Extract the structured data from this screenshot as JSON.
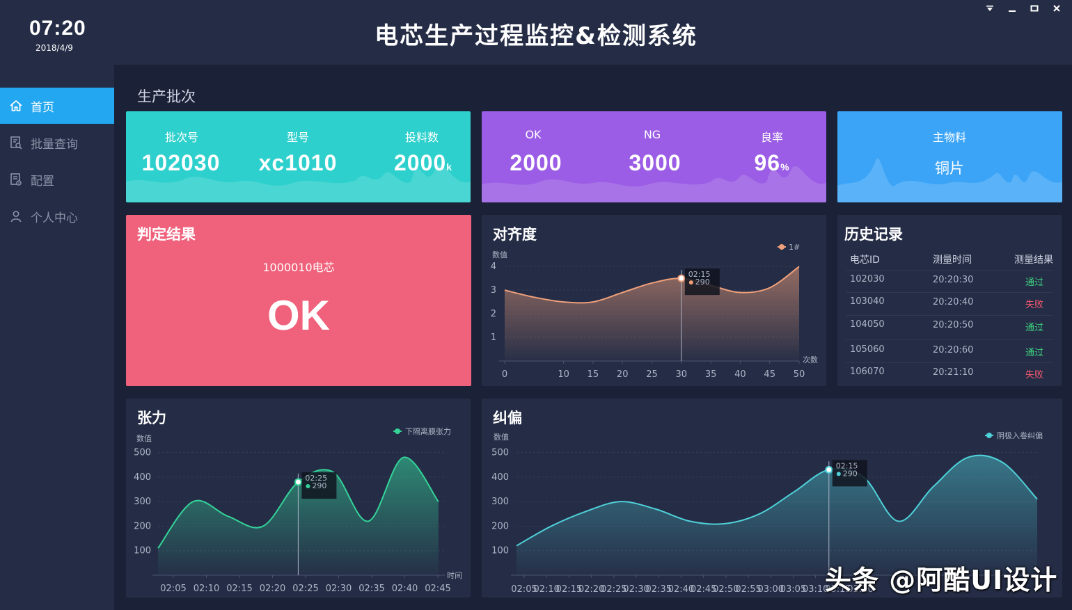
{
  "header": {
    "time": "07:20",
    "date": "2018/4/9",
    "title": "电芯生产过程监控&检测系统"
  },
  "window_controls": [
    "dropdown-icon",
    "minimize-icon",
    "maximize-icon",
    "close-icon"
  ],
  "sidebar": {
    "items": [
      {
        "label": "首页",
        "icon": "home-icon",
        "active": true
      },
      {
        "label": "批量查询",
        "icon": "search-doc-icon",
        "active": false
      },
      {
        "label": "配置",
        "icon": "config-doc-icon",
        "active": false
      },
      {
        "label": "个人中心",
        "icon": "user-icon",
        "active": false
      }
    ]
  },
  "batch": {
    "section_title": "生产批次",
    "card1": {
      "color": "#2dd0cc",
      "items": [
        {
          "label": "批次号",
          "value": "102030",
          "unit": ""
        },
        {
          "label": "型号",
          "value": "xc1010",
          "unit": ""
        },
        {
          "label": "投料数",
          "value": "2000",
          "unit": "k"
        }
      ]
    },
    "card2": {
      "color": "#9b5de5",
      "items": [
        {
          "label": "OK",
          "value": "2000",
          "unit": ""
        },
        {
          "label": "NG",
          "value": "3000",
          "unit": ""
        },
        {
          "label": "良率",
          "value": "96",
          "unit": "%"
        }
      ]
    },
    "card3": {
      "color": "#3ba4f7",
      "label": "主物料",
      "value": "铜片"
    }
  },
  "judgement": {
    "title": "判定结果",
    "cell_id": "1000010电芯",
    "result": "OK",
    "color": "#f0627c"
  },
  "alignment": {
    "title": "对齐度",
    "ylabel": "数值",
    "xlabel": "次数",
    "legend": "1#",
    "tooltip_time": "02:15",
    "tooltip_value": "290"
  },
  "history": {
    "title": "历史记录",
    "columns": [
      "电芯ID",
      "测量时间",
      "测量结果"
    ],
    "rows": [
      {
        "id": "102030",
        "time": "20:20:30",
        "result": "通过",
        "status": "ok"
      },
      {
        "id": "103040",
        "time": "20:20:40",
        "result": "失败",
        "status": "fail"
      },
      {
        "id": "104050",
        "time": "20:20:50",
        "result": "通过",
        "status": "ok"
      },
      {
        "id": "105060",
        "time": "20:20:60",
        "result": "通过",
        "status": "ok"
      },
      {
        "id": "106070",
        "time": "20:21:10",
        "result": "失败",
        "status": "fail"
      }
    ]
  },
  "tension": {
    "title": "张力",
    "ylabel": "数值",
    "xlabel": "时间",
    "legend": "下隔离膜张力",
    "tooltip_time": "02:25",
    "tooltip_value": "290"
  },
  "deviation": {
    "title": "纠偏",
    "ylabel": "数值",
    "legend": "阴极入卷纠偏",
    "tooltip_time": "02:15",
    "tooltip_value": "290"
  },
  "watermark": "头条 @阿酷UI设计",
  "chart_data": [
    {
      "type": "area",
      "title": "对齐度",
      "xlabel": "次数",
      "ylabel": "数值",
      "series": [
        {
          "name": "1#",
          "x": [
            0,
            5,
            10,
            15,
            20,
            25,
            30,
            35,
            40,
            45,
            50
          ],
          "values": [
            3.0,
            2.7,
            2.5,
            2.5,
            2.9,
            3.3,
            3.5,
            3.2,
            2.9,
            3.1,
            4.0
          ]
        }
      ],
      "xticks": [
        0,
        10,
        15,
        20,
        25,
        30,
        35,
        40,
        45,
        50
      ],
      "yticks": [
        1,
        2,
        3,
        4
      ],
      "xlim": [
        0,
        50
      ],
      "ylim": [
        0,
        4.3
      ],
      "color": "#f0a07a",
      "grid": true,
      "legend": "top-right"
    },
    {
      "type": "area",
      "title": "张力",
      "xlabel": "时间",
      "ylabel": "数值",
      "series": [
        {
          "name": "下隔离膜张力",
          "x": [
            "02:05",
            "02:10",
            "02:15",
            "02:20",
            "02:25",
            "02:30",
            "02:35",
            "02:40",
            "02:45"
          ],
          "values": [
            110,
            300,
            240,
            200,
            380,
            420,
            220,
            480,
            300
          ]
        }
      ],
      "yticks": [
        100,
        200,
        300,
        400,
        500
      ],
      "ylim": [
        0,
        550
      ],
      "color": "#34d399",
      "grid": true,
      "legend": "top-right"
    },
    {
      "type": "area",
      "title": "纠偏",
      "ylabel": "数值",
      "series": [
        {
          "name": "阴极入卷纠偏",
          "x": [
            "02:05",
            "02:10",
            "02:15",
            "02:20",
            "02:25",
            "02:30",
            "02:35",
            "02:40",
            "02:45",
            "02:50",
            "02:55",
            "03:00",
            "03:05",
            "03:10",
            "03:15",
            "03:20"
          ],
          "values": [
            120,
            200,
            260,
            300,
            270,
            220,
            210,
            250,
            340,
            430,
            400,
            220,
            360,
            480,
            460,
            310
          ]
        }
      ],
      "yticks": [
        100,
        200,
        300,
        400,
        500
      ],
      "ylim": [
        0,
        550
      ],
      "color": "#4fd1d9",
      "grid": true,
      "legend": "top-right"
    }
  ]
}
